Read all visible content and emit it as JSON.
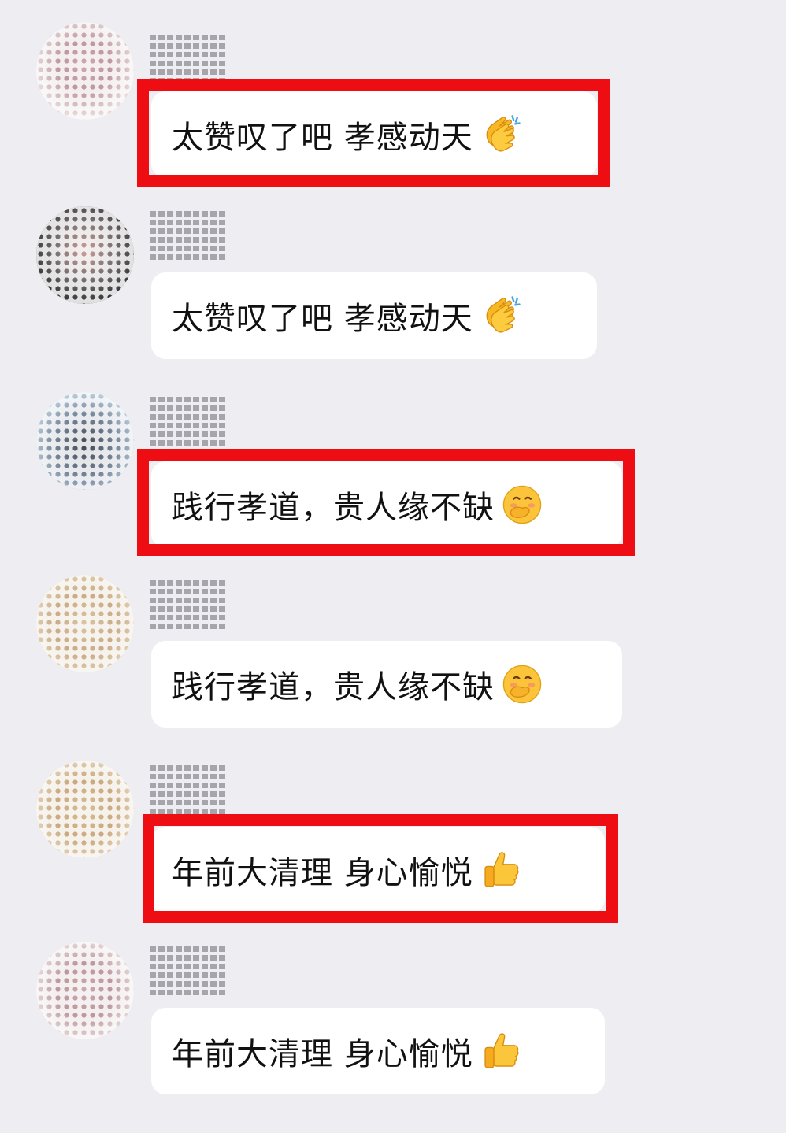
{
  "chat": {
    "messages": [
      {
        "text": "太赞叹了吧 孝感动天",
        "emoji": "clapping-hands-emoji",
        "highlighted": true
      },
      {
        "text": "太赞叹了吧 孝感动天",
        "emoji": "clapping-hands-emoji",
        "highlighted": false
      },
      {
        "text": "践行孝道，贵人缘不缺",
        "emoji": "hand-over-mouth-smile-emoji",
        "highlighted": true
      },
      {
        "text": "践行孝道，贵人缘不缺",
        "emoji": "hand-over-mouth-smile-emoji",
        "highlighted": false
      },
      {
        "text": "年前大清理  身心愉悦",
        "emoji": "thumbs-up-emoji",
        "highlighted": true
      },
      {
        "text": "年前大清理  身心愉悦",
        "emoji": "thumbs-up-emoji",
        "highlighted": false
      }
    ]
  },
  "colors": {
    "background": "#ededf2",
    "bubble": "#ffffff",
    "highlight_border": "#ee0d12",
    "text": "#111111"
  }
}
